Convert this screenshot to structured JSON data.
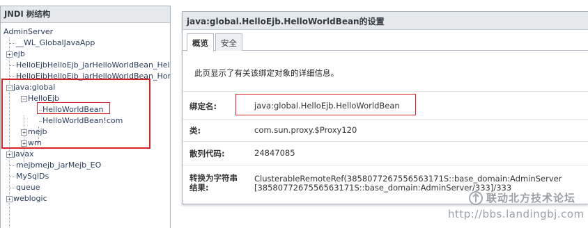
{
  "tree_panel": {
    "title": "JNDI 树结构",
    "items": [
      {
        "label": "AdminServer",
        "toggle": ""
      },
      {
        "label": "__WL_GlobalJavaApp",
        "toggle": ""
      },
      {
        "label": "ejb",
        "toggle": "+"
      },
      {
        "label": "HelloEjbHelloEjb_jarHelloWorldBean_HelloWor",
        "toggle": ""
      },
      {
        "label": "HelloEjbHelloEjb_jarHelloWorldBean_HomeH",
        "toggle": ""
      },
      {
        "label": "java:global",
        "toggle": "−"
      },
      {
        "label": "HelloEjb",
        "toggle": "−"
      },
      {
        "label": "HelloWorldBean",
        "toggle": ""
      },
      {
        "label": "HelloWorldBean!com",
        "toggle": ""
      },
      {
        "label": "mejb",
        "toggle": "+"
      },
      {
        "label": "wm",
        "toggle": "+"
      },
      {
        "label": "javax",
        "toggle": "+"
      },
      {
        "label": "mejbmejb_jarMejb_EO",
        "toggle": ""
      },
      {
        "label": "MySqlDs",
        "toggle": ""
      },
      {
        "label": "queue",
        "toggle": ""
      },
      {
        "label": "weblogic",
        "toggle": "+"
      }
    ]
  },
  "settings_panel": {
    "title": "java:global.HelloEjb.HelloWorldBean的设置",
    "tabs": [
      {
        "label": "概览",
        "active": true
      },
      {
        "label": "安全",
        "active": false
      }
    ],
    "intro": "此页显示了有关该绑定对象的详细信息。",
    "fields": [
      {
        "label": "绑定名:",
        "value": "java:global.HelloEjb.HelloWorldBean"
      },
      {
        "label": "类:",
        "value": "com.sun.proxy.$Proxy120"
      },
      {
        "label": "散列代码:",
        "value": "24847085"
      },
      {
        "label": "转换为字符串结果:",
        "label_line1": "转换为字符串",
        "label_line2": "结果:",
        "value_line1": "ClusterableRemoteRef(3858077267556563171S::base_domain:AdminServer",
        "value_line2": "[3858077267556563171S::base_domain:AdminServer/333]/333"
      }
    ]
  },
  "watermark": {
    "title": "联动北方技术论坛",
    "url": "http://bbs.landingbj.com"
  },
  "colors": {
    "highlight": "#d8232a",
    "panel_header": "#e6e9ec",
    "border": "#a9b3bd",
    "tree_text": "#2b3d5b"
  }
}
